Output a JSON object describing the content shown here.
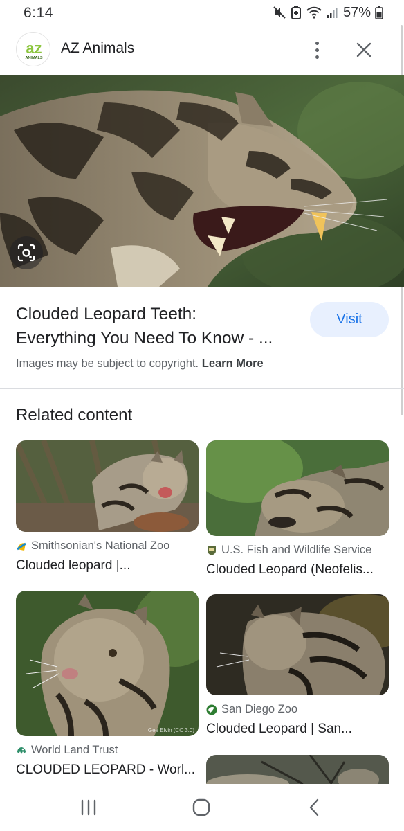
{
  "status_bar": {
    "time": "6:14",
    "battery": "57%",
    "icons": [
      "mute-icon",
      "data-saver-icon",
      "wifi-icon",
      "signal-icon",
      "battery-icon"
    ]
  },
  "header": {
    "site_name": "AZ Animals",
    "logo_text": "az",
    "logo_subtext": "ANIMALS"
  },
  "result": {
    "title_line1": "Clouded Leopard Teeth:",
    "title_line2": "Everything You Need To Know - ...",
    "visit_label": "Visit",
    "copyright_text": "Images may be subject to copyright.",
    "learn_more": "Learn More"
  },
  "related": {
    "heading": "Related content",
    "cards": [
      {
        "source": "Smithsonian's National Zoo",
        "title": "Clouded leopard |...",
        "favicon": "smithsonian-favicon"
      },
      {
        "source": "U.S. Fish and Wildlife Service",
        "title": "Clouded Leopard (Neofelis...",
        "favicon": "fws-favicon"
      },
      {
        "source": "World Land Trust",
        "title": "CLOUDED LEOPARD - Worl...",
        "favicon": "wlt-favicon",
        "photo_credit": "Gee Elvin (CC 3.0)"
      },
      {
        "source": "San Diego Zoo",
        "title": "Clouded Leopard | San...",
        "favicon": "sdzoo-favicon"
      }
    ]
  },
  "nav_bar": {
    "buttons": [
      "recent-apps",
      "home",
      "back"
    ]
  },
  "colors": {
    "accent": "#1a73e8",
    "visit_bg": "#e8f0fe",
    "text_primary": "#202124",
    "text_secondary": "#5f6368",
    "logo_green": "#8dc63f"
  }
}
